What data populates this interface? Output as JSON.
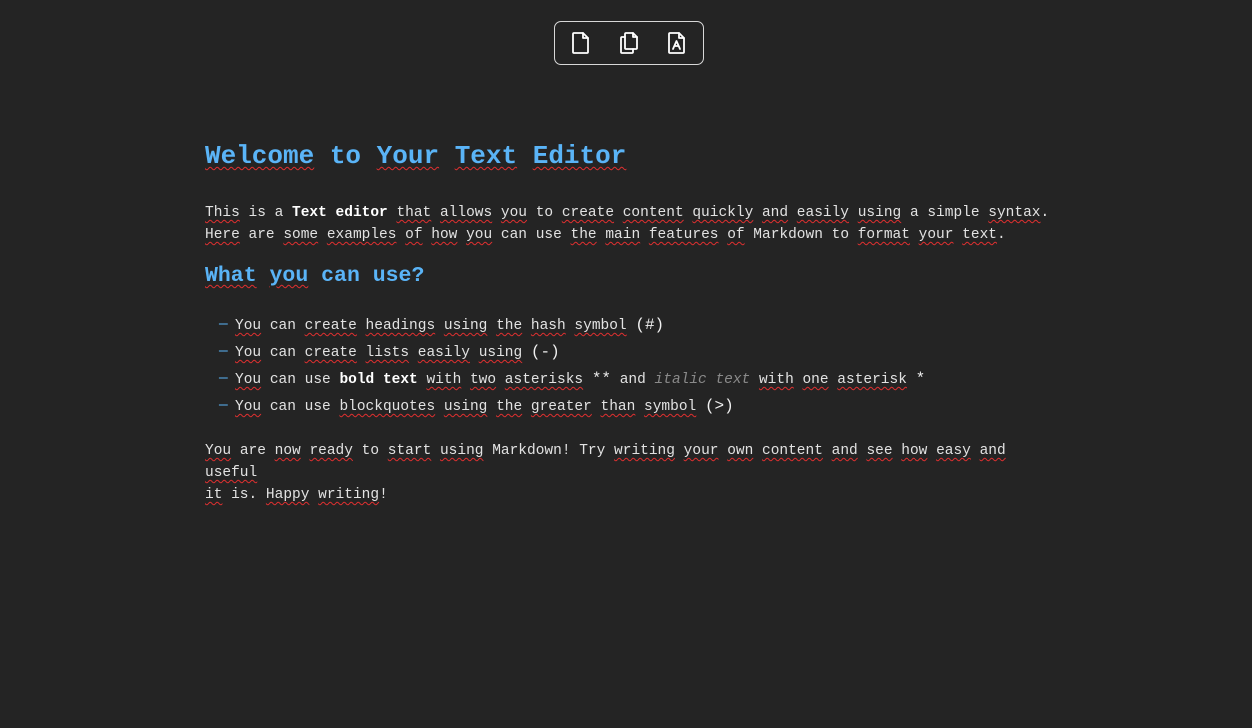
{
  "toolbar": {
    "buttons": [
      {
        "name": "new-document-icon"
      },
      {
        "name": "copy-document-icon"
      },
      {
        "name": "export-pdf-icon"
      }
    ]
  },
  "doc": {
    "title": [
      "Welcome",
      "to",
      "Your",
      "Text",
      "Editor"
    ],
    "intro": {
      "p1_before": "This",
      "p1_is_a": "is a",
      "p1_bold": "Text editor",
      "p1_that": "that",
      "p1_allows": "allows",
      "p1_you": "you",
      "p1_to": "to",
      "p1_create": "create",
      "p1_content": "content",
      "p1_quickly": "quickly",
      "p1_and": "and",
      "p1_easily": "easily",
      "p1_using": "using",
      "p1_asimple": "a simple",
      "p1_syntax": "syntax",
      "p1_dot": ".",
      "p2_here": "Here",
      "p2_are": "are",
      "p2_some": "some",
      "p2_examples": "examples",
      "p2_of": "of",
      "p2_how": "how",
      "p2_you": "you",
      "p2_canuse": "can use",
      "p2_the": "the",
      "p2_main": "main",
      "p2_features": "features",
      "p2_of2": "of",
      "p2_markdown": "Markdown",
      "p2_to": "to",
      "p2_format": "format",
      "p2_your": "your",
      "p2_text": "text",
      "p2_dot": "."
    },
    "subtitle": {
      "what": "What",
      "you": "you",
      "rest": "can use?"
    },
    "list": {
      "dash": "—",
      "i1": {
        "you": "You",
        "can": "can",
        "create": "create",
        "headings": "headings",
        "using": "using",
        "the": "the",
        "hash": "hash",
        "symbol": "symbol",
        "sym": "(#)"
      },
      "i2": {
        "you": "You",
        "can": "can",
        "create": "create",
        "lists": "lists",
        "easily": "easily",
        "using": "using",
        "sym": "(-)"
      },
      "i3": {
        "you": "You",
        "canuse": "can use",
        "bold": "bold text",
        "with": "with",
        "two": "two",
        "asterisks": "asterisks",
        "sym1": "**",
        "and": "and",
        "italic": "italic text",
        "with2": "with",
        "one": "one",
        "asterisk": "asterisk",
        "sym2": "*"
      },
      "i4": {
        "you": "You",
        "canuse": "can use",
        "blockquotes": "blockquotes",
        "using": "using",
        "the": "the",
        "greater": "greater",
        "than": "than",
        "symbol": "symbol",
        "sym": "(>)"
      }
    },
    "outro": {
      "you": "You",
      "are": "are",
      "now": "now",
      "ready": "ready",
      "to": "to",
      "start": "start",
      "using": "using",
      "markdown": "Markdown",
      "try": "! Try",
      "writing": "writing",
      "your": "your",
      "own": "own",
      "content": "content",
      "and": "and",
      "see": "see",
      "how": "how",
      "easy": "easy",
      "and2": "and",
      "useful": "useful",
      "it": "it",
      "is": "is.",
      "happy": "Happy",
      "writing2": "writing",
      "excl": "!"
    }
  },
  "colors": {
    "background": "#242424",
    "heading": "#5ab4f7",
    "text": "#e2e2e2",
    "spellcheck": "#e03030"
  }
}
